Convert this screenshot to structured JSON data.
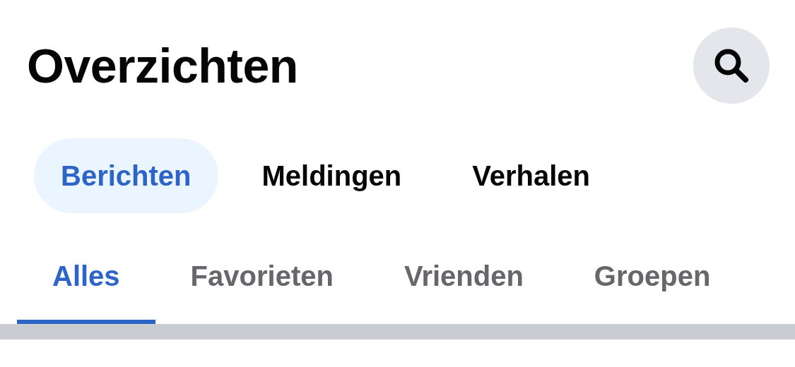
{
  "header": {
    "title": "Overzichten"
  },
  "sections": [
    {
      "label": "Berichten",
      "selected": true
    },
    {
      "label": "Meldingen",
      "selected": false
    },
    {
      "label": "Verhalen",
      "selected": false
    }
  ],
  "filters": [
    {
      "label": "Alles",
      "selected": true
    },
    {
      "label": "Favorieten",
      "selected": false
    },
    {
      "label": "Vrienden",
      "selected": false
    },
    {
      "label": "Groepen",
      "selected": false
    }
  ]
}
